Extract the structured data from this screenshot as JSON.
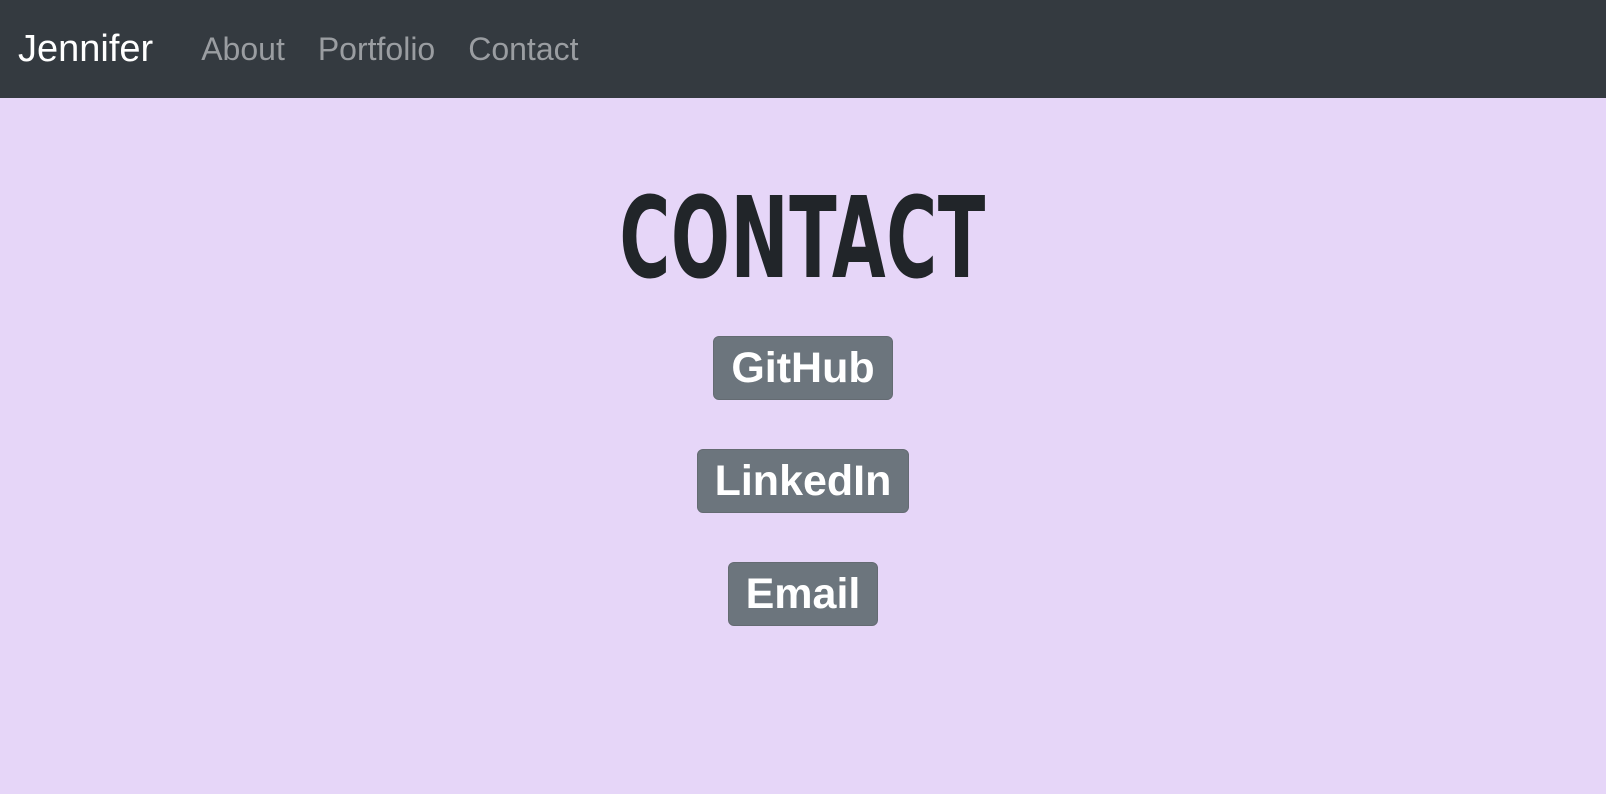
{
  "navbar": {
    "brand": "Jennifer",
    "links": [
      {
        "label": "About"
      },
      {
        "label": "Portfolio"
      },
      {
        "label": "Contact"
      }
    ]
  },
  "page": {
    "title": "CONTACT"
  },
  "buttons": {
    "github": "GitHub",
    "linkedin": "LinkedIn",
    "email": "Email"
  },
  "colors": {
    "navbar_background": "#343a40",
    "page_background": "#e6d6f8",
    "button_background": "#6c757d",
    "nav_link_color": "#9a9da1",
    "title_color": "#212529"
  }
}
